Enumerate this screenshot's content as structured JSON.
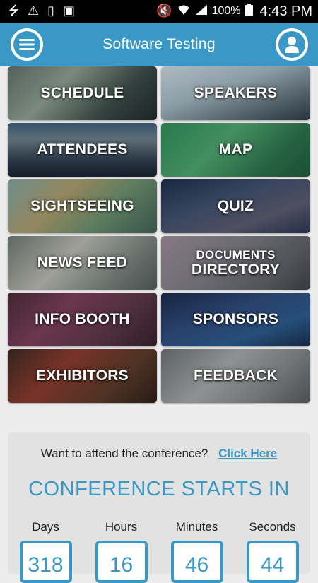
{
  "status_bar": {
    "battery_percent": "100%",
    "time": "4:43 PM",
    "icons": [
      "usb-icon",
      "warning-icon",
      "battery-100-icon",
      "sim-error-icon",
      "mute-icon",
      "wifi-icon",
      "signal-icon",
      "battery-icon"
    ]
  },
  "header": {
    "title": "Software Testing",
    "menu_icon": "menu-icon",
    "profile_icon": "user-icon"
  },
  "tiles": [
    {
      "label": "SCHEDULE"
    },
    {
      "label": "SPEAKERS"
    },
    {
      "label": "ATTENDEES"
    },
    {
      "label": "MAP"
    },
    {
      "label": "SIGHTSEEING"
    },
    {
      "label": "QUIZ"
    },
    {
      "label": "NEWS FEED"
    },
    {
      "label": "DOCUMENTS",
      "label2": "DIRECTORY"
    },
    {
      "label": "INFO BOOTH"
    },
    {
      "label": "SPONSORS"
    },
    {
      "label": "EXHIBITORS"
    },
    {
      "label": "FEEDBACK"
    }
  ],
  "countdown": {
    "attend_text": "Want to attend the conference?",
    "attend_link": "Click Here",
    "heading": "CONFERENCE STARTS IN",
    "units": [
      {
        "label": "Days",
        "value": "318"
      },
      {
        "label": "Hours",
        "value": "16"
      },
      {
        "label": "Minutes",
        "value": "46"
      },
      {
        "label": "Seconds",
        "value": "44"
      }
    ]
  },
  "colors": {
    "accent": "#3a98c6",
    "background": "#ececec",
    "card": "#e2e2e2"
  }
}
